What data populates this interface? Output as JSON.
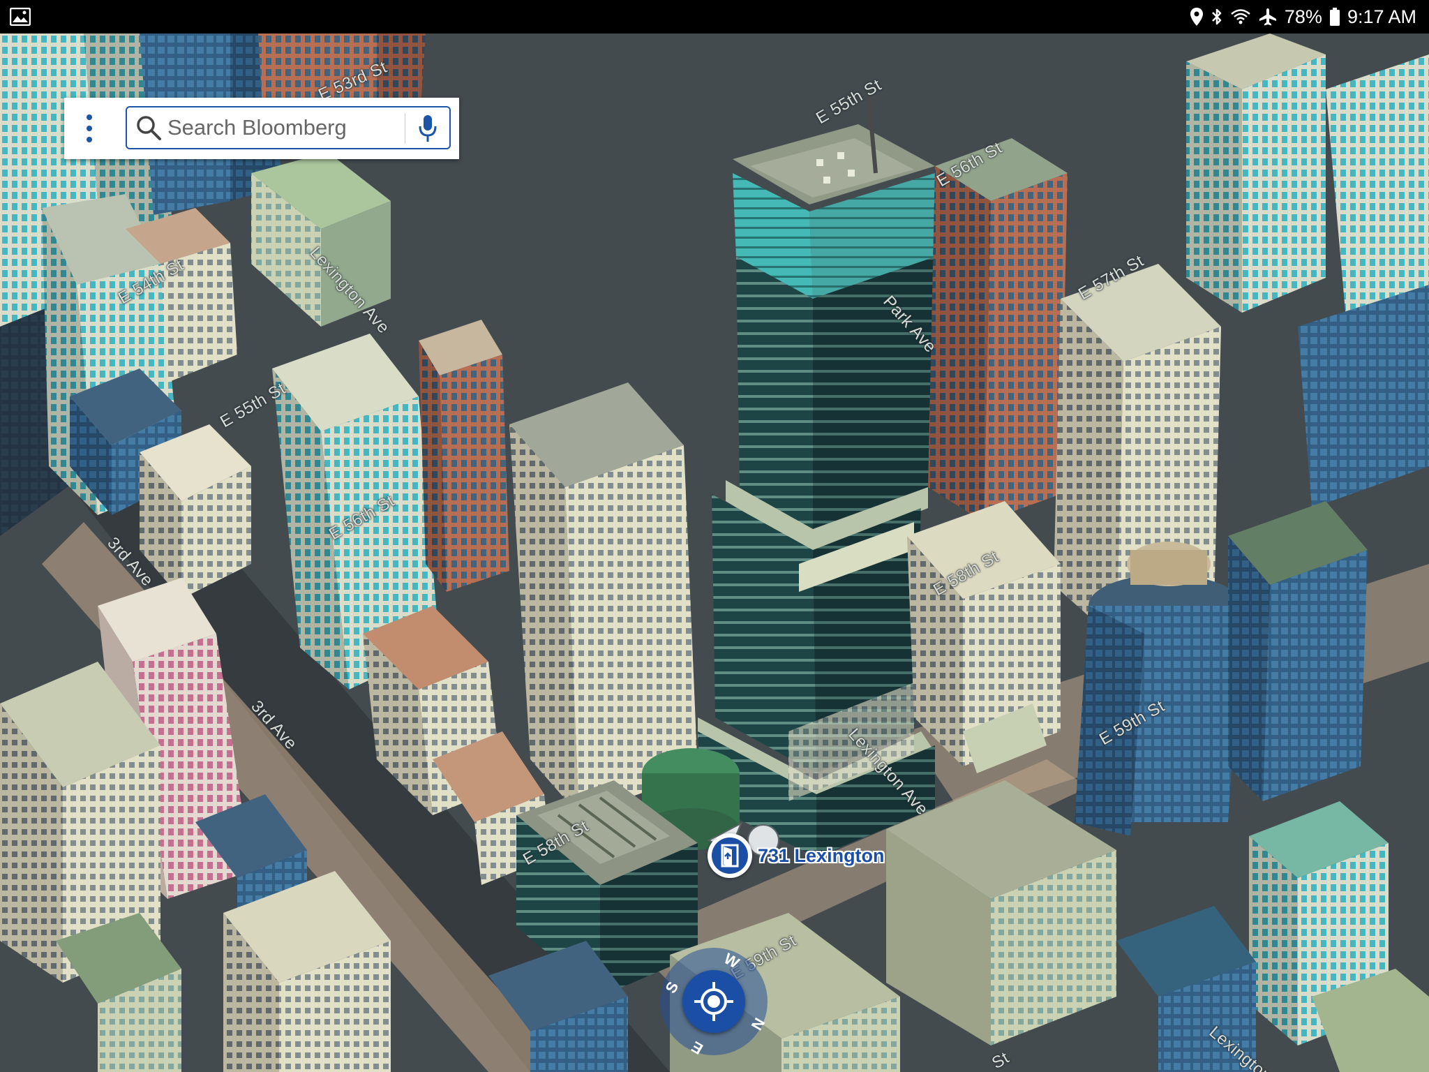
{
  "status_bar": {
    "battery": "78%",
    "time": "9:17 AM",
    "icons": [
      "gallery-icon",
      "location-icon",
      "bluetooth-icon",
      "wifi-icon",
      "airplane-icon",
      "battery-icon"
    ]
  },
  "search": {
    "placeholder": "Search Bloomberg",
    "value": ""
  },
  "map": {
    "street_labels": [
      "E 53rd St",
      "E 55th St",
      "E 56th St",
      "Lexington Ave",
      "E 54th St",
      "Park Ave",
      "E 57th St",
      "E 55th St",
      "E 56th St",
      "3rd Ave",
      "E 58th St",
      "3rd Ave",
      "Lexington Ave",
      "E 59th St",
      "E 58th St",
      "E 59th St",
      "Lexington Ave",
      "St"
    ],
    "poi": {
      "label": "731 Lexington",
      "icon": "building-entrance-icon"
    }
  },
  "compass": {
    "letters": [
      "S",
      "W",
      "N",
      "E"
    ]
  },
  "colors": {
    "accent": "#1b4fa6",
    "status_bar": "#000000"
  }
}
